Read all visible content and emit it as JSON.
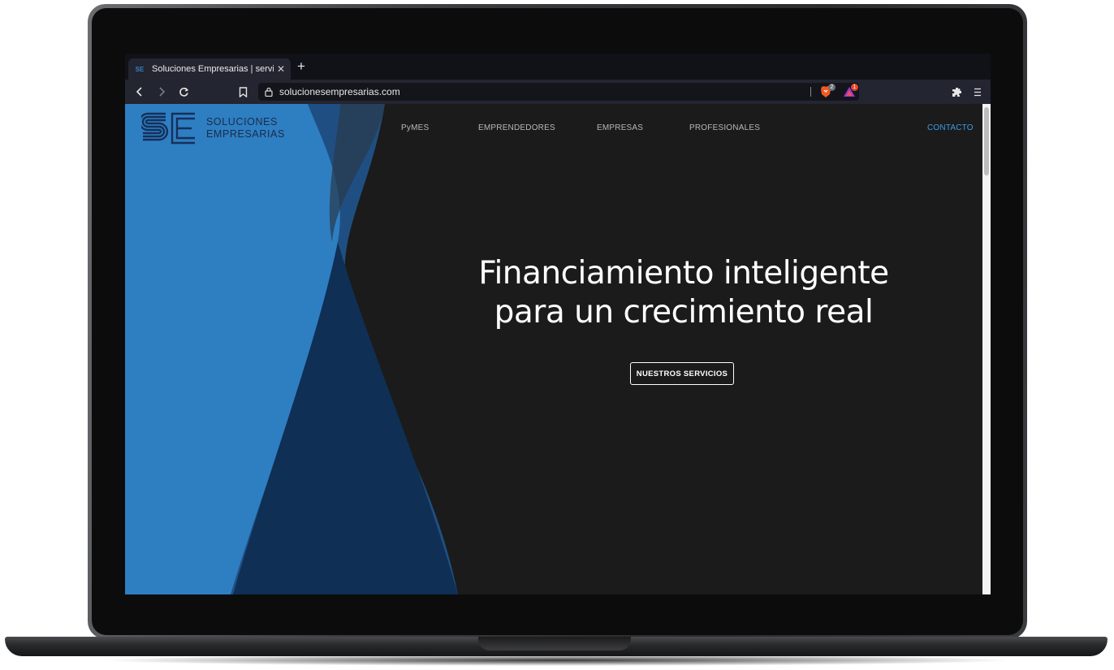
{
  "browser": {
    "tab": {
      "favicon_text": "SE",
      "title": "Soluciones Empresarias | servicios",
      "close_glyph": "✕"
    },
    "new_tab_glyph": "+",
    "url": "solucionesempresarias.com",
    "shields_count": "2",
    "rewards_count": "1",
    "icons": [
      "back-icon",
      "forward-icon",
      "reload-icon",
      "bookmark-icon",
      "lock-icon",
      "brave-shields-icon",
      "brave-rewards-icon",
      "extensions-icon",
      "menu-icon"
    ]
  },
  "site": {
    "logo": {
      "mark": "SE",
      "line1": "SOLUCIONES",
      "line2": "EMPRESARIAS"
    },
    "nav": {
      "pymes": "PyMES",
      "emprendedores": "EMPRENDEDORES",
      "empresas": "EMPRESAS",
      "profesionales": "PROFESIONALES",
      "contacto": "CONTACTO"
    },
    "hero": {
      "line1": "Financiamiento inteligente",
      "line2": "para un crecimiento real"
    },
    "cta_label": "NUESTROS SERVICIOS"
  },
  "colors": {
    "page_background": "#1b1b1b",
    "wave_light": "#2f7fc1",
    "wave_mid": "#1a4f82",
    "wave_dark": "#0f2f55",
    "accent_contact": "#3b9de6"
  }
}
